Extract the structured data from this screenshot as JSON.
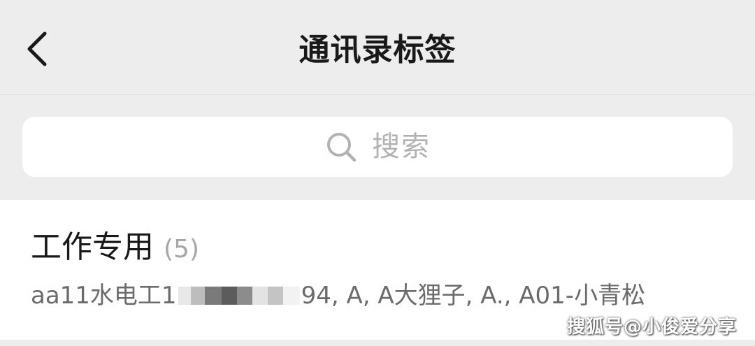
{
  "header": {
    "title": "通讯录标签",
    "back_icon": "chevron-left-icon"
  },
  "search": {
    "placeholder": "搜索",
    "icon": "search-icon"
  },
  "tags": [
    {
      "name": "工作专用",
      "count": "(5)",
      "members_prefix": "aa11水电工1",
      "members_suffix": "94, A, A大狸子, A., A01-小青松"
    }
  ],
  "watermark": "搜狐号@小俊爱分享",
  "colors": {
    "background": "#ededed",
    "card": "#ffffff",
    "title_text": "#191919",
    "secondary_text": "#6b6b6b",
    "placeholder_text": "#b2b2b2"
  }
}
